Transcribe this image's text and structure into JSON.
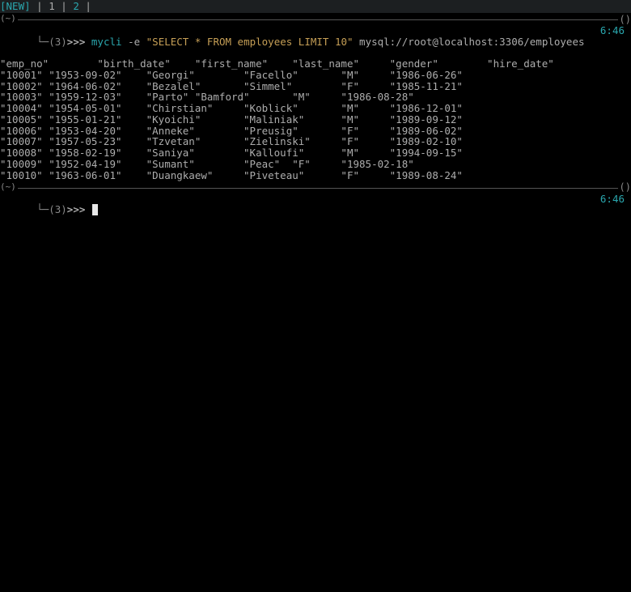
{
  "statusbar": {
    "new_label": "[NEW]",
    "sep": " | ",
    "tab1": "1",
    "tab2": "2",
    "trail": " |"
  },
  "prompt1": {
    "tilde": "(~)",
    "bracket_open": "└─",
    "num": "(3)",
    "angles": ">>> ",
    "cmd": "mycli",
    "flag": " -e ",
    "query": "\"SELECT * FROM employees LIMIT 10\"",
    "uri": " mysql://root@localhost:3306/employees",
    "time": "6:46"
  },
  "prompt2": {
    "tilde": "(~)",
    "bracket_open": "└─",
    "num": "(3)",
    "angles": ">>> ",
    "time": "6:46"
  },
  "headers": "\"emp_no\"        \"birth_date\"    \"first_name\"    \"last_name\"     \"gender\"        \"hire_date\"",
  "rows": [
    "\"10001\" \"1953-09-02\"    \"Georgi\"        \"Facello\"       \"M\"     \"1986-06-26\"",
    "\"10002\" \"1964-06-02\"    \"Bezalel\"       \"Simmel\"        \"F\"     \"1985-11-21\"",
    "\"10003\" \"1959-12-03\"    \"Parto\" \"Bamford\"       \"M\"     \"1986-08-28\"",
    "\"10004\" \"1954-05-01\"    \"Chirstian\"     \"Koblick\"       \"M\"     \"1986-12-01\"",
    "\"10005\" \"1955-01-21\"    \"Kyoichi\"       \"Maliniak\"      \"M\"     \"1989-09-12\"",
    "\"10006\" \"1953-04-20\"    \"Anneke\"        \"Preusig\"       \"F\"     \"1989-06-02\"",
    "\"10007\" \"1957-05-23\"    \"Tzvetan\"       \"Zielinski\"     \"F\"     \"1989-02-10\"",
    "\"10008\" \"1958-02-19\"    \"Saniya\"        \"Kalloufi\"      \"M\"     \"1994-09-15\"",
    "\"10009\" \"1952-04-19\"    \"Sumant\"        \"Peac\"  \"F\"     \"1985-02-18\"",
    "\"10010\" \"1963-06-01\"    \"Duangkaew\"     \"Piveteau\"      \"F\"     \"1989-08-24\""
  ]
}
